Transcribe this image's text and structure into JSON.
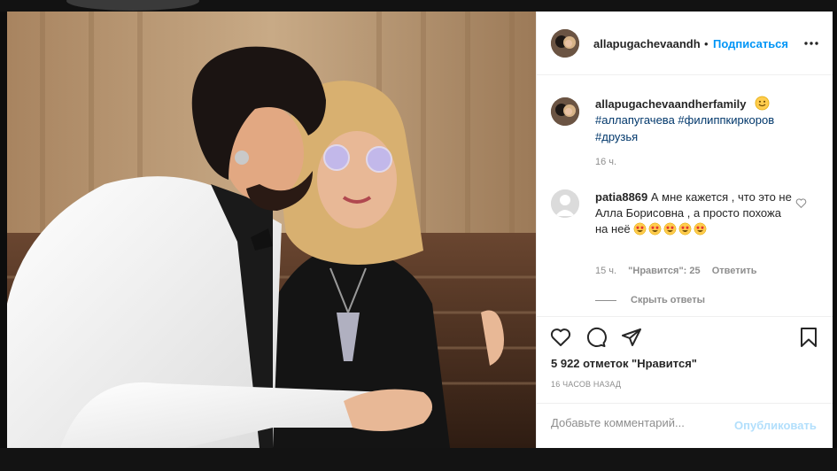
{
  "post": {
    "photo_alt": "allapugachevaandherfamily",
    "header": {
      "username": "allapugachevaandh",
      "dot": "•",
      "follow_label": "Подписаться",
      "more_icon": "more-horizontal-icon"
    },
    "caption": {
      "username": "allapugachevaandherfamily",
      "emoji": "smiling-face-icon",
      "hashtags_line1": "#аллапугачева #филиппкиркоров",
      "hashtags_line2": "#друзья",
      "time": "16 ч."
    },
    "comment": {
      "username": "patia8869",
      "text": " А мне кажется , что это не Алла Борисовна , а просто похожа на неё ",
      "emoji": "star-struck-icon",
      "emoji_count": 5,
      "time": "15 ч.",
      "likes": "\"Нравится\": 25",
      "reply_label": "Ответить",
      "hide_replies_label": "Скрыть ответы"
    },
    "actions": {
      "like_icon": "heart-icon",
      "comment_icon": "comment-icon",
      "share_icon": "share-icon",
      "save_icon": "bookmark-icon"
    },
    "likes_count": "5 922 отметок \"Нравится\"",
    "posted": "16 ЧАСОВ НАЗАД",
    "add_comment": {
      "placeholder": "Добавьте комментарий...",
      "publish_label": "Опубликовать"
    },
    "colors": {
      "accent": "#0095f6",
      "hashtag": "#00376b",
      "muted": "#8e8e8e",
      "text": "#262626",
      "publish_disabled": "#b2dffc"
    }
  }
}
